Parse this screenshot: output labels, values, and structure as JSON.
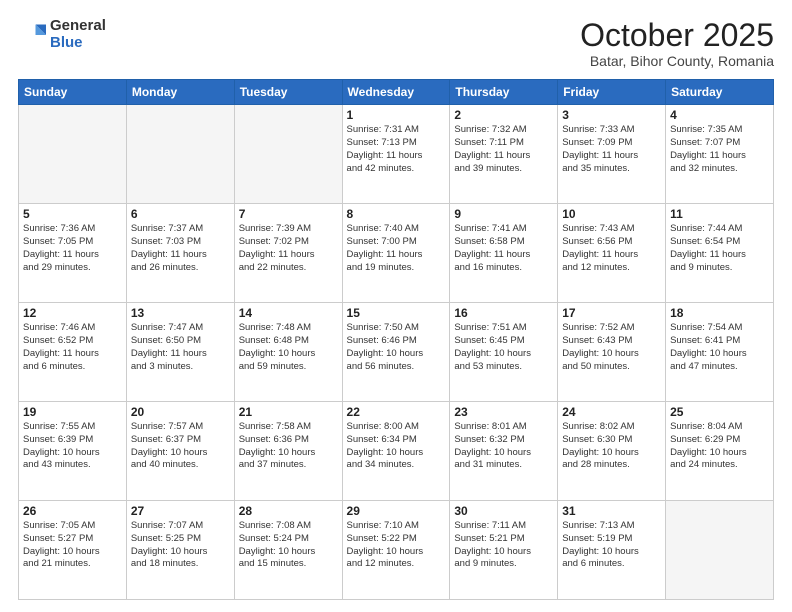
{
  "logo": {
    "general": "General",
    "blue": "Blue"
  },
  "header": {
    "month": "October 2025",
    "location": "Batar, Bihor County, Romania"
  },
  "weekdays": [
    "Sunday",
    "Monday",
    "Tuesday",
    "Wednesday",
    "Thursday",
    "Friday",
    "Saturday"
  ],
  "weeks": [
    [
      {
        "day": "",
        "info": ""
      },
      {
        "day": "",
        "info": ""
      },
      {
        "day": "",
        "info": ""
      },
      {
        "day": "1",
        "info": "Sunrise: 7:31 AM\nSunset: 7:13 PM\nDaylight: 11 hours\nand 42 minutes."
      },
      {
        "day": "2",
        "info": "Sunrise: 7:32 AM\nSunset: 7:11 PM\nDaylight: 11 hours\nand 39 minutes."
      },
      {
        "day": "3",
        "info": "Sunrise: 7:33 AM\nSunset: 7:09 PM\nDaylight: 11 hours\nand 35 minutes."
      },
      {
        "day": "4",
        "info": "Sunrise: 7:35 AM\nSunset: 7:07 PM\nDaylight: 11 hours\nand 32 minutes."
      }
    ],
    [
      {
        "day": "5",
        "info": "Sunrise: 7:36 AM\nSunset: 7:05 PM\nDaylight: 11 hours\nand 29 minutes."
      },
      {
        "day": "6",
        "info": "Sunrise: 7:37 AM\nSunset: 7:03 PM\nDaylight: 11 hours\nand 26 minutes."
      },
      {
        "day": "7",
        "info": "Sunrise: 7:39 AM\nSunset: 7:02 PM\nDaylight: 11 hours\nand 22 minutes."
      },
      {
        "day": "8",
        "info": "Sunrise: 7:40 AM\nSunset: 7:00 PM\nDaylight: 11 hours\nand 19 minutes."
      },
      {
        "day": "9",
        "info": "Sunrise: 7:41 AM\nSunset: 6:58 PM\nDaylight: 11 hours\nand 16 minutes."
      },
      {
        "day": "10",
        "info": "Sunrise: 7:43 AM\nSunset: 6:56 PM\nDaylight: 11 hours\nand 12 minutes."
      },
      {
        "day": "11",
        "info": "Sunrise: 7:44 AM\nSunset: 6:54 PM\nDaylight: 11 hours\nand 9 minutes."
      }
    ],
    [
      {
        "day": "12",
        "info": "Sunrise: 7:46 AM\nSunset: 6:52 PM\nDaylight: 11 hours\nand 6 minutes."
      },
      {
        "day": "13",
        "info": "Sunrise: 7:47 AM\nSunset: 6:50 PM\nDaylight: 11 hours\nand 3 minutes."
      },
      {
        "day": "14",
        "info": "Sunrise: 7:48 AM\nSunset: 6:48 PM\nDaylight: 10 hours\nand 59 minutes."
      },
      {
        "day": "15",
        "info": "Sunrise: 7:50 AM\nSunset: 6:46 PM\nDaylight: 10 hours\nand 56 minutes."
      },
      {
        "day": "16",
        "info": "Sunrise: 7:51 AM\nSunset: 6:45 PM\nDaylight: 10 hours\nand 53 minutes."
      },
      {
        "day": "17",
        "info": "Sunrise: 7:52 AM\nSunset: 6:43 PM\nDaylight: 10 hours\nand 50 minutes."
      },
      {
        "day": "18",
        "info": "Sunrise: 7:54 AM\nSunset: 6:41 PM\nDaylight: 10 hours\nand 47 minutes."
      }
    ],
    [
      {
        "day": "19",
        "info": "Sunrise: 7:55 AM\nSunset: 6:39 PM\nDaylight: 10 hours\nand 43 minutes."
      },
      {
        "day": "20",
        "info": "Sunrise: 7:57 AM\nSunset: 6:37 PM\nDaylight: 10 hours\nand 40 minutes."
      },
      {
        "day": "21",
        "info": "Sunrise: 7:58 AM\nSunset: 6:36 PM\nDaylight: 10 hours\nand 37 minutes."
      },
      {
        "day": "22",
        "info": "Sunrise: 8:00 AM\nSunset: 6:34 PM\nDaylight: 10 hours\nand 34 minutes."
      },
      {
        "day": "23",
        "info": "Sunrise: 8:01 AM\nSunset: 6:32 PM\nDaylight: 10 hours\nand 31 minutes."
      },
      {
        "day": "24",
        "info": "Sunrise: 8:02 AM\nSunset: 6:30 PM\nDaylight: 10 hours\nand 28 minutes."
      },
      {
        "day": "25",
        "info": "Sunrise: 8:04 AM\nSunset: 6:29 PM\nDaylight: 10 hours\nand 24 minutes."
      }
    ],
    [
      {
        "day": "26",
        "info": "Sunrise: 7:05 AM\nSunset: 5:27 PM\nDaylight: 10 hours\nand 21 minutes."
      },
      {
        "day": "27",
        "info": "Sunrise: 7:07 AM\nSunset: 5:25 PM\nDaylight: 10 hours\nand 18 minutes."
      },
      {
        "day": "28",
        "info": "Sunrise: 7:08 AM\nSunset: 5:24 PM\nDaylight: 10 hours\nand 15 minutes."
      },
      {
        "day": "29",
        "info": "Sunrise: 7:10 AM\nSunset: 5:22 PM\nDaylight: 10 hours\nand 12 minutes."
      },
      {
        "day": "30",
        "info": "Sunrise: 7:11 AM\nSunset: 5:21 PM\nDaylight: 10 hours\nand 9 minutes."
      },
      {
        "day": "31",
        "info": "Sunrise: 7:13 AM\nSunset: 5:19 PM\nDaylight: 10 hours\nand 6 minutes."
      },
      {
        "day": "",
        "info": ""
      }
    ]
  ]
}
